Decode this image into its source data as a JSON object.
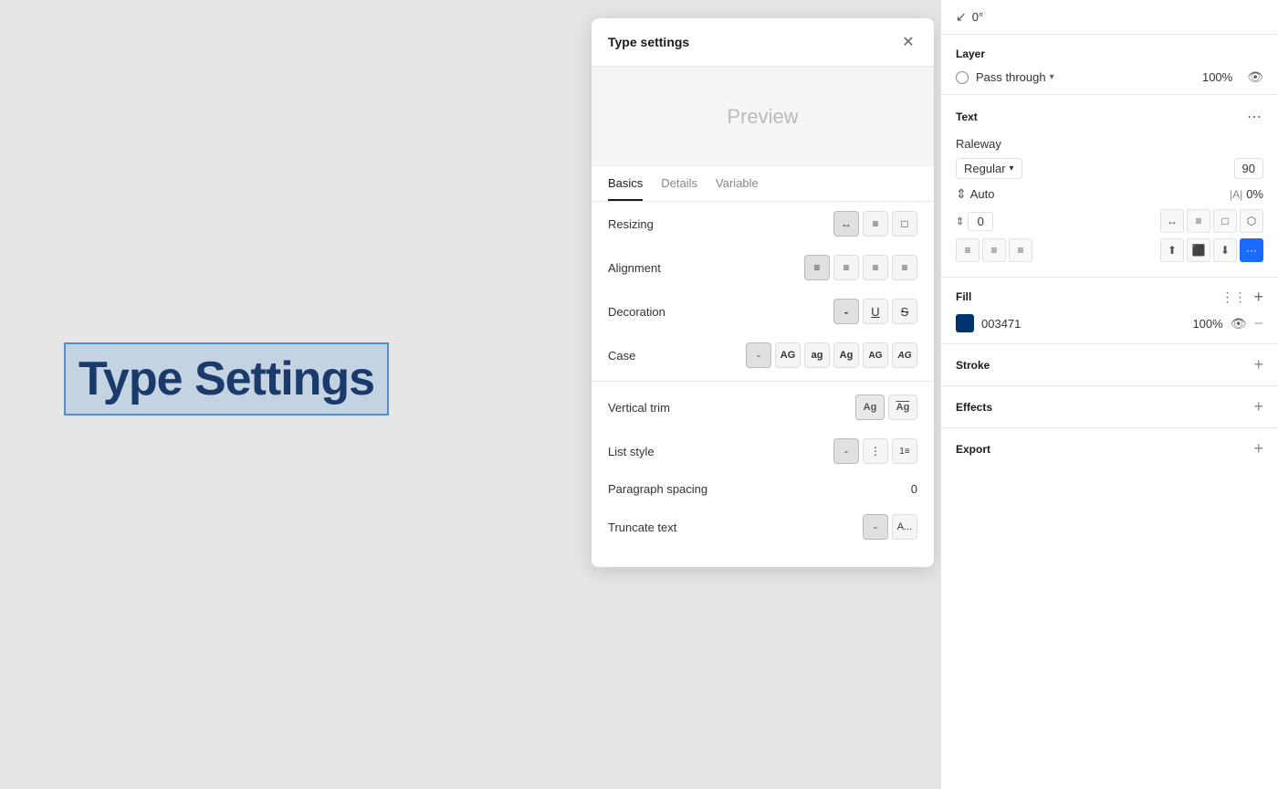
{
  "canvas": {
    "text_element": "Type Settings"
  },
  "type_settings_panel": {
    "title": "Type settings",
    "close_label": "✕",
    "preview_text": "Preview",
    "tabs": [
      {
        "label": "Basics",
        "active": true
      },
      {
        "label": "Details",
        "active": false
      },
      {
        "label": "Variable",
        "active": false
      }
    ],
    "rows": {
      "resizing": {
        "label": "Resizing"
      },
      "alignment": {
        "label": "Alignment"
      },
      "decoration": {
        "label": "Decoration"
      },
      "case": {
        "label": "Case"
      },
      "vertical_trim": {
        "label": "Vertical trim"
      },
      "list_style": {
        "label": "List style"
      },
      "paragraph_spacing": {
        "label": "Paragraph spacing",
        "value": "0"
      },
      "truncate_text": {
        "label": "Truncate text"
      }
    },
    "case_buttons": [
      "-",
      "AG",
      "ag",
      "Ag",
      "AG",
      "AG"
    ],
    "truncate_options": [
      "-",
      "A..."
    ]
  },
  "right_panel": {
    "rotation": {
      "icon": "↙",
      "value": "0°"
    },
    "layer": {
      "title": "Layer",
      "blend_mode": "Pass through",
      "opacity": "100%"
    },
    "text": {
      "title": "Text",
      "font_name": "Raleway",
      "style": "Regular",
      "size": "90",
      "auto_label": "Auto",
      "spacing_icon_label": "|A|",
      "spacing_percent": "0%",
      "line_height_value": "0",
      "decoration_dots": "···"
    },
    "fill": {
      "title": "Fill",
      "color_hex": "003471",
      "opacity": "100%"
    },
    "stroke": {
      "title": "Stroke"
    },
    "effects": {
      "title": "Effects"
    },
    "export": {
      "title": "Export"
    }
  }
}
